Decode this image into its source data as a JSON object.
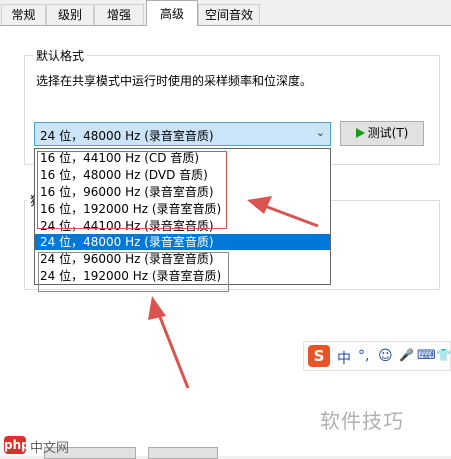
{
  "tabs": [
    {
      "label": "常规"
    },
    {
      "label": "级别"
    },
    {
      "label": "增强"
    },
    {
      "label": "高级"
    },
    {
      "label": "空间音效"
    }
  ],
  "default_format": {
    "title": "默认格式",
    "description": "选择在共享模式中运行时使用的采样频率和位深度。",
    "selected_value": "24 位，48000 Hz (录音室音质)",
    "test_button_label": "测试(T)"
  },
  "second_group_title_partial": "独",
  "format_options": [
    "16 位，44100 Hz (CD 音质)",
    "16 位，48000 Hz (DVD 音质)",
    "16 位，96000 Hz (录音室音质)",
    "16 位，192000 Hz (录音室音质)",
    "24 位，44100 Hz (录音室音质)",
    "24 位，48000 Hz (录音室音质)",
    "24 位，96000 Hz (录音室音质)",
    "24 位，192000 Hz (录音室音质)"
  ],
  "selected_option_index": 5,
  "ime_toolbar": {
    "logo": "S",
    "items": [
      "中",
      "°,",
      "☺",
      "🎤",
      "⌨",
      "👕"
    ]
  },
  "watermark": {
    "text": "软件技巧",
    "logo_letters": "php",
    "logo_label": "中文网"
  },
  "colors": {
    "selection": "#0078d7",
    "combo_bg": "#cce4f7",
    "annotation_red": "#d9534f",
    "ime_orange": "#e8542a"
  }
}
